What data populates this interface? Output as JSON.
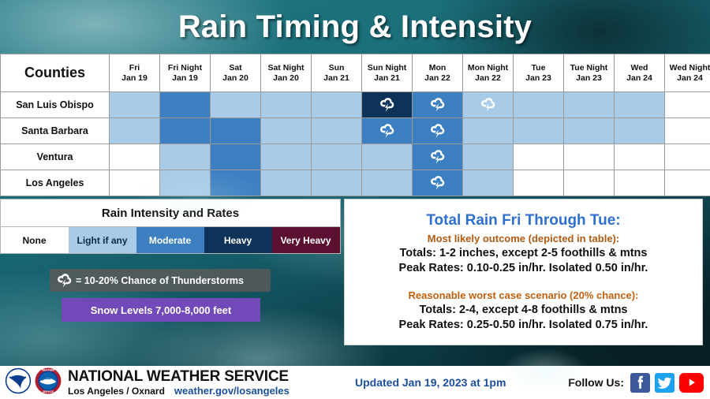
{
  "header": {
    "title": "Rain Timing & Intensity"
  },
  "table": {
    "corner_label": "Counties",
    "columns": [
      {
        "day": "Fri",
        "date": "Jan 19"
      },
      {
        "day": "Fri Night",
        "date": "Jan 19"
      },
      {
        "day": "Sat",
        "date": "Jan 20"
      },
      {
        "day": "Sat Night",
        "date": "Jan 20"
      },
      {
        "day": "Sun",
        "date": "Jan 21"
      },
      {
        "day": "Sun Night",
        "date": "Jan 21"
      },
      {
        "day": "Mon",
        "date": "Jan 22"
      },
      {
        "day": "Mon Night",
        "date": "Jan 22"
      },
      {
        "day": "Tue",
        "date": "Jan 23"
      },
      {
        "day": "Tue Night",
        "date": "Jan 23"
      },
      {
        "day": "Wed",
        "date": "Jan 24"
      },
      {
        "day": "Wed Night",
        "date": "Jan 24"
      }
    ],
    "rows": [
      {
        "county": "San Luis Obispo",
        "cells": [
          {
            "intensity": "light"
          },
          {
            "intensity": "moderate"
          },
          {
            "intensity": "light"
          },
          {
            "intensity": "light"
          },
          {
            "intensity": "light"
          },
          {
            "intensity": "heavy",
            "storm": true
          },
          {
            "intensity": "moderate",
            "storm": true
          },
          {
            "intensity": "light",
            "storm": true
          },
          {
            "intensity": "light"
          },
          {
            "intensity": "light"
          },
          {
            "intensity": "light"
          },
          {
            "intensity": "none"
          }
        ]
      },
      {
        "county": "Santa Barbara",
        "cells": [
          {
            "intensity": "light"
          },
          {
            "intensity": "moderate"
          },
          {
            "intensity": "moderate"
          },
          {
            "intensity": "light"
          },
          {
            "intensity": "light"
          },
          {
            "intensity": "moderate",
            "storm": true
          },
          {
            "intensity": "moderate",
            "storm": true
          },
          {
            "intensity": "light"
          },
          {
            "intensity": "light"
          },
          {
            "intensity": "light"
          },
          {
            "intensity": "light"
          },
          {
            "intensity": "none"
          }
        ]
      },
      {
        "county": "Ventura",
        "cells": [
          {
            "intensity": "none"
          },
          {
            "intensity": "light"
          },
          {
            "intensity": "moderate"
          },
          {
            "intensity": "light"
          },
          {
            "intensity": "light"
          },
          {
            "intensity": "light"
          },
          {
            "intensity": "moderate",
            "storm": true
          },
          {
            "intensity": "light"
          },
          {
            "intensity": "none"
          },
          {
            "intensity": "none"
          },
          {
            "intensity": "none"
          },
          {
            "intensity": "none"
          }
        ]
      },
      {
        "county": "Los Angeles",
        "cells": [
          {
            "intensity": "none"
          },
          {
            "intensity": "light"
          },
          {
            "intensity": "moderate"
          },
          {
            "intensity": "light"
          },
          {
            "intensity": "light"
          },
          {
            "intensity": "light"
          },
          {
            "intensity": "moderate",
            "storm": true
          },
          {
            "intensity": "light"
          },
          {
            "intensity": "none"
          },
          {
            "intensity": "none"
          },
          {
            "intensity": "none"
          },
          {
            "intensity": "none"
          }
        ]
      }
    ]
  },
  "legend": {
    "title": "Rain Intensity and Rates",
    "scale": [
      {
        "label": "None",
        "color": "#ffffff",
        "key": "none"
      },
      {
        "label": "Light if any",
        "color": "#a8cbe8",
        "key": "light"
      },
      {
        "label": "Moderate",
        "color": "#3d80c2",
        "key": "mod"
      },
      {
        "label": "Heavy",
        "color": "#0d3358",
        "key": "heavy"
      },
      {
        "label": "Very Heavy",
        "color": "#5c1031",
        "key": "very"
      }
    ],
    "thunderstorm_note": "= 10-20% Chance of Thunderstorms",
    "snow_note": "Snow Levels 7,000-8,000 feet"
  },
  "info": {
    "heading": "Total Rain Fri Through Tue:",
    "likely_label": "Most likely outcome (depicted in table):",
    "likely_totals": "Totals: 1-2 inches, except 2-5 foothills & mtns",
    "likely_rates": "Peak Rates: 0.10-0.25 in/hr. Isolated 0.50 in/hr.",
    "worst_label": "Reasonable worst case scenario (20% chance):",
    "worst_totals": "Totals: 2-4, except 4-8 foothills & mtns",
    "worst_rates": "Peak Rates: 0.25-0.50 in/hr. Isolated 0.75 in/hr."
  },
  "footer": {
    "agency": "NATIONAL WEATHER SERVICE",
    "office": "Los Angeles / Oxnard",
    "url": "weather.gov/losangeles",
    "updated": "Updated Jan 19, 2023 at 1pm",
    "follow_label": "Follow Us:"
  },
  "colors": {
    "accent_blue": "#1b4f9c",
    "heading_blue": "#2f6fd0",
    "orange": "#b05a12",
    "purple": "#7149b8",
    "teal_bg": "#145c68"
  }
}
